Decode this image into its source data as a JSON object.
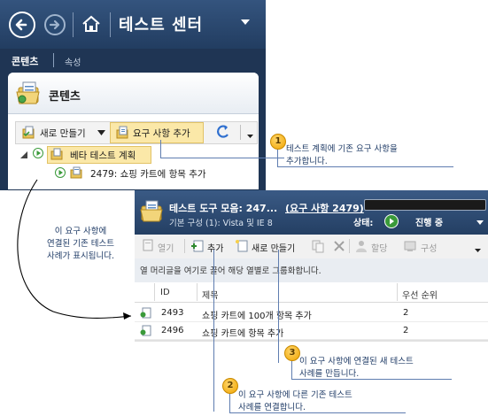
{
  "app": {
    "title": "테스트 센터",
    "tabs": [
      {
        "label": "콘텐츠",
        "active": true
      },
      {
        "label": "속성",
        "active": false
      }
    ]
  },
  "content_panel": {
    "title": "콘텐츠",
    "toolbar": {
      "new_label": "새로 만들기",
      "add_requirement_label": "요구 사항 추가"
    },
    "tree": [
      {
        "label": "베타 테스트 계획",
        "type": "suite",
        "highlighted": true
      },
      {
        "label": "2479: 쇼핑 카트에 항목 추가",
        "type": "requirement"
      }
    ]
  },
  "callouts": [
    {
      "number": "1",
      "lines": [
        "테스트 계획에 기존 요구 사항을",
        "추가합니다."
      ]
    },
    {
      "number": "2",
      "lines": [
        "이 요구 사항에 다른 기존 테스트",
        "사례를 연결합니다."
      ]
    },
    {
      "number": "3",
      "lines": [
        "이 요구 사항에 연결된 새 테스트",
        "사례를 만듭니다."
      ]
    }
  ],
  "left_note": [
    "이 요구 사항에",
    "연결된 기존 테스트",
    "사례가 표시됩니다."
  ],
  "suite_panel": {
    "title": "테스트 도구 모음: 247...",
    "title_link": "(요구 사항 2479)",
    "subtitle": "기본 구성 (1): Vista 및 IE 8",
    "status_label": "상태:",
    "status_value": "진행 중",
    "toolbar": {
      "open_label": "열기",
      "add_label": "추가",
      "new_label": "새로 만들기",
      "assign_label": "할당",
      "configure_label": "구성"
    },
    "group_hint": "열 머리글을 여기로 끌어 해당 열별로 그룹화합니다.",
    "columns": [
      "ID",
      "제목",
      "우선 순위"
    ],
    "rows": [
      {
        "id": "2493",
        "title": "쇼핑 카트에 100개 항목 추가",
        "priority": "2"
      },
      {
        "id": "2496",
        "title": "쇼핑 카트에 항목 추가",
        "priority": "2"
      }
    ]
  },
  "colors": {
    "header_dark": "#1f3554",
    "highlight": "#fbe8a8",
    "callout_text": "#1f3b66",
    "callout_badge": "#f0a400"
  }
}
